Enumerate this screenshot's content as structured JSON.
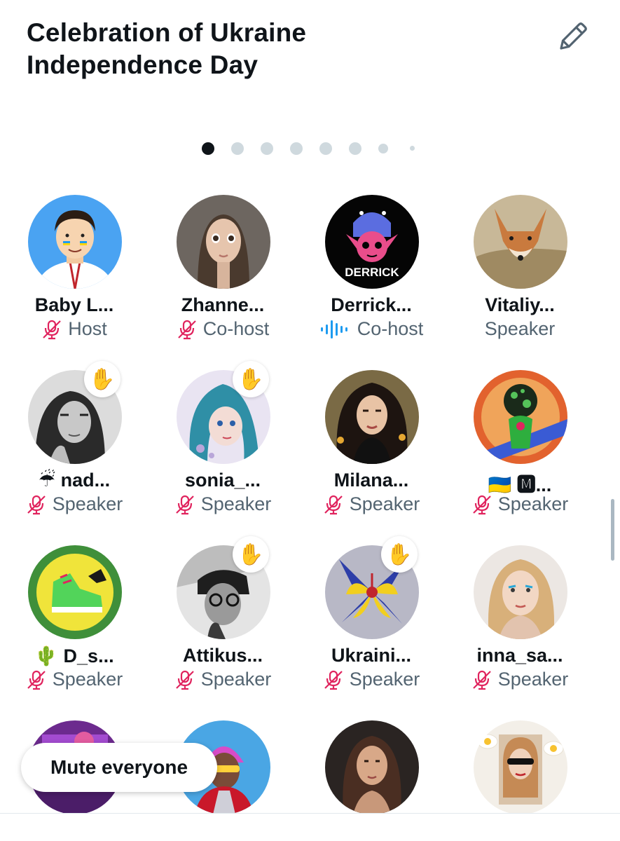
{
  "space": {
    "title": "Celebration of Ukraine Independence Day"
  },
  "carousel": {
    "page_count": 8,
    "active_index": 0
  },
  "colors": {
    "mic_off": "#e0245e",
    "speaking": "#1d9bf0",
    "role_text": "#536471"
  },
  "participants": [
    {
      "name": "Baby L...",
      "role": "Host",
      "mic": "mic-off-icon",
      "hand": false,
      "avatar": "cartoon-man-avatar"
    },
    {
      "name": "Zhanne...",
      "role": "Co-host",
      "mic": "mic-off-icon",
      "hand": false,
      "avatar": "woman-portrait-avatar"
    },
    {
      "name": "Derrick...",
      "role": "Co-host",
      "mic": "speaking-waveform-icon",
      "hand": false,
      "avatar": "derrick-logo-avatar"
    },
    {
      "name": "Vitaliy...",
      "role": "Speaker",
      "mic": "none",
      "hand": false,
      "avatar": "fox-avatar"
    },
    {
      "name": "☔ nad...",
      "role": "Speaker",
      "mic": "mic-off-icon",
      "hand": true,
      "avatar": "bw-woman-avatar"
    },
    {
      "name": "sonia_...",
      "role": "Speaker",
      "mic": "mic-off-icon",
      "hand": true,
      "avatar": "anime-girl-avatar"
    },
    {
      "name": "Milana...",
      "role": "Speaker",
      "mic": "mic-off-icon",
      "hand": false,
      "avatar": "woman-curly-hair-avatar"
    },
    {
      "name": "🇺🇦 🅼...",
      "role": "Speaker",
      "mic": "mic-off-icon",
      "hand": false,
      "avatar": "3d-art-avatar"
    },
    {
      "name": "🌵 D_s...",
      "role": "Speaker",
      "mic": "mic-off-icon",
      "hand": false,
      "avatar": "sneaker-avatar"
    },
    {
      "name": "Attikus...",
      "role": "Speaker",
      "mic": "mic-off-icon",
      "hand": true,
      "avatar": "bw-man-avatar"
    },
    {
      "name": "Ukraini...",
      "role": "Speaker",
      "mic": "mic-off-icon",
      "hand": true,
      "avatar": "flower-avatar"
    },
    {
      "name": "inna_sa...",
      "role": "Speaker",
      "mic": "mic-off-icon",
      "hand": false,
      "avatar": "blonde-woman-avatar"
    },
    {
      "name": "",
      "role": "",
      "mic": "none",
      "hand": false,
      "avatar": "purple-art-avatar"
    },
    {
      "name": "",
      "role": "",
      "mic": "none",
      "hand": false,
      "avatar": "cyberpunk-avatar"
    },
    {
      "name": "",
      "role": "",
      "mic": "none",
      "hand": false,
      "avatar": "woman-dark-hair-avatar"
    },
    {
      "name": "",
      "role": "",
      "mic": "none",
      "hand": false,
      "avatar": "sunglasses-woman-avatar"
    }
  ],
  "hand_emoji": "✋",
  "actions": {
    "mute_everyone_label": "Mute everyone"
  }
}
